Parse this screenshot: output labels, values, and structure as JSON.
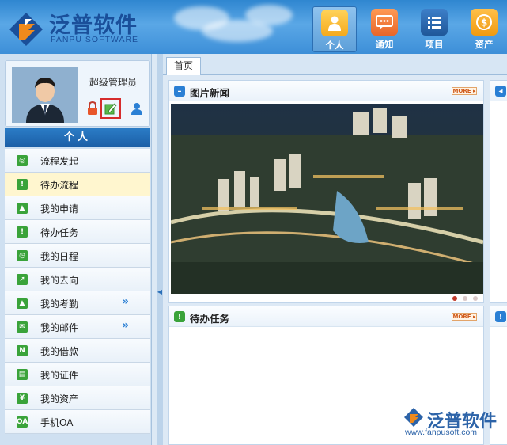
{
  "header": {
    "logo_cn": "泛普软件",
    "logo_en": "FANPU SOFTWARE",
    "nav": [
      {
        "label": "个人",
        "icon": "person-icon",
        "color": "#f5b51c"
      },
      {
        "label": "通知",
        "icon": "chat-icon",
        "color": "#f07a32"
      },
      {
        "label": "项目",
        "icon": "list-icon",
        "color": "#2f6db5"
      },
      {
        "label": "资产",
        "icon": "coin-icon",
        "color": "#f0a61c"
      }
    ]
  },
  "user": {
    "name": "超级管理员"
  },
  "sidebar": {
    "section_title": "个人",
    "items": [
      {
        "label": "流程发起",
        "icon": "flow-start-icon",
        "badge": "◎",
        "color": "#3aa33a",
        "expand": ""
      },
      {
        "label": "待办流程",
        "icon": "todo-flow-icon",
        "badge": "!",
        "color": "#3aa33a",
        "expand": ""
      },
      {
        "label": "我的申请",
        "icon": "application-icon",
        "badge": "▲",
        "color": "#3aa33a",
        "expand": ""
      },
      {
        "label": "待办任务",
        "icon": "task-icon",
        "badge": "!",
        "color": "#3aa33a",
        "expand": ""
      },
      {
        "label": "我的日程",
        "icon": "schedule-icon",
        "badge": "◷",
        "color": "#3aa33a",
        "expand": ""
      },
      {
        "label": "我的去向",
        "icon": "whereabouts-icon",
        "badge": "➚",
        "color": "#3aa33a",
        "expand": ""
      },
      {
        "label": "我的考勤",
        "icon": "attendance-icon",
        "badge": "▲",
        "color": "#3aa33a",
        "expand": "»"
      },
      {
        "label": "我的邮件",
        "icon": "mail-icon",
        "badge": "✉",
        "color": "#3aa33a",
        "expand": "»"
      },
      {
        "label": "我的借款",
        "icon": "loan-icon",
        "badge": "N",
        "color": "#3aa33a",
        "expand": ""
      },
      {
        "label": "我的证件",
        "icon": "certificate-icon",
        "badge": "▤",
        "color": "#3aa33a",
        "expand": ""
      },
      {
        "label": "我的资产",
        "icon": "asset-icon",
        "badge": "¥",
        "color": "#3aa33a",
        "expand": ""
      },
      {
        "label": "手机OA",
        "icon": "mobile-oa-icon",
        "badge": "OA",
        "color": "#3aa33a",
        "expand": ""
      }
    ]
  },
  "tabs": {
    "home": "首页"
  },
  "panels": {
    "news_title": "图片新闻",
    "tasks_title": "待办任务",
    "more_label": "MORE ▸"
  },
  "watermark": {
    "cn": "泛普软件",
    "url": "www.fanpusoft.com"
  }
}
